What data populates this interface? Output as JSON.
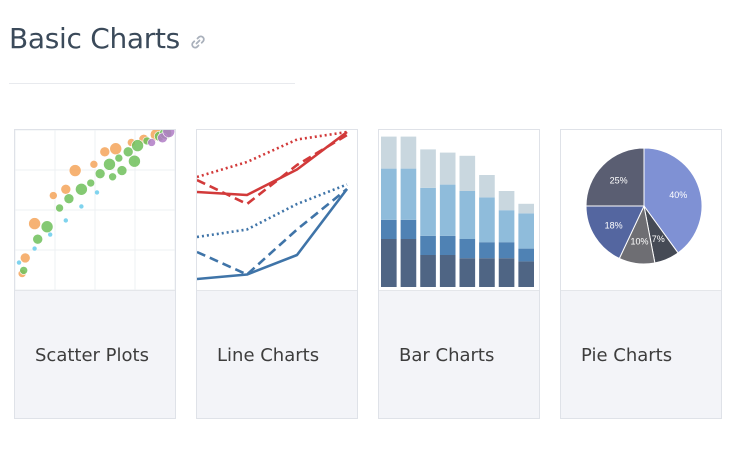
{
  "section": {
    "title": "Basic Charts",
    "link_icon": "link-icon"
  },
  "cards": [
    {
      "id": "scatter",
      "label": "Scatter Plots",
      "thumb_type": "scatter"
    },
    {
      "id": "line",
      "label": "Line Charts",
      "thumb_type": "line"
    },
    {
      "id": "bar",
      "label": "Bar Charts",
      "thumb_type": "bar"
    },
    {
      "id": "pie",
      "label": "Pie Charts",
      "thumb_type": "pie"
    }
  ],
  "chart_data": [
    {
      "type": "scatter",
      "title": "",
      "series": [
        {
          "color": "#f5a55a",
          "points": [
            [
              2,
              8
            ],
            [
              4,
              18
            ],
            [
              10,
              40
            ],
            [
              22,
              58
            ],
            [
              30,
              62
            ],
            [
              36,
              74
            ],
            [
              48,
              78
            ],
            [
              55,
              86
            ],
            [
              62,
              88
            ],
            [
              72,
              92
            ],
            [
              80,
              94
            ],
            [
              88,
              97
            ]
          ]
        },
        {
          "color": "#6fbf5a",
          "points": [
            [
              3,
              10
            ],
            [
              12,
              30
            ],
            [
              18,
              38
            ],
            [
              26,
              50
            ],
            [
              32,
              56
            ],
            [
              40,
              62
            ],
            [
              46,
              66
            ],
            [
              52,
              72
            ],
            [
              58,
              78
            ],
            [
              64,
              82
            ],
            [
              70,
              86
            ],
            [
              76,
              90
            ],
            [
              82,
              93
            ],
            [
              90,
              96
            ],
            [
              94,
              98
            ],
            [
              60,
              70
            ],
            [
              66,
              74
            ],
            [
              74,
              80
            ]
          ]
        },
        {
          "color": "#b07cc6",
          "points": [
            [
              85,
              92
            ],
            [
              92,
              95
            ],
            [
              96,
              99
            ]
          ]
        },
        {
          "color": "#7fd3ee",
          "points": [
            [
              0,
              15
            ],
            [
              10,
              24
            ],
            [
              20,
              33
            ],
            [
              30,
              42
            ],
            [
              40,
              51
            ],
            [
              50,
              60
            ]
          ]
        }
      ]
    },
    {
      "type": "line",
      "title": "",
      "series": [
        {
          "color": "#d23a3a",
          "style": "solid",
          "values": [
            60,
            58,
            75,
            100
          ]
        },
        {
          "color": "#d23a3a",
          "style": "dash",
          "values": [
            68,
            52,
            78,
            98
          ]
        },
        {
          "color": "#d23a3a",
          "style": "dot",
          "values": [
            70,
            80,
            95,
            100
          ]
        },
        {
          "color": "#3f74a8",
          "style": "solid",
          "values": [
            2,
            5,
            18,
            62
          ]
        },
        {
          "color": "#3f74a8",
          "style": "dash",
          "values": [
            20,
            5,
            35,
            62
          ]
        },
        {
          "color": "#3f74a8",
          "style": "dot",
          "values": [
            30,
            35,
            52,
            65
          ]
        }
      ]
    },
    {
      "type": "bar",
      "title": "",
      "colors": [
        "#4f6584",
        "#4f82b4",
        "#8fbcdb",
        "#c9d7df"
      ],
      "series": [
        {
          "values": [
            30,
            30,
            20,
            20,
            18,
            18,
            18,
            16
          ]
        },
        {
          "values": [
            12,
            12,
            12,
            12,
            12,
            10,
            10,
            8
          ]
        },
        {
          "values": [
            32,
            32,
            30,
            32,
            30,
            28,
            20,
            22
          ]
        },
        {
          "values": [
            20,
            20,
            24,
            20,
            22,
            14,
            12,
            6
          ]
        }
      ]
    },
    {
      "type": "pie",
      "title": "",
      "slices": [
        {
          "label": "40%",
          "value": 40,
          "color": "#7f91d4"
        },
        {
          "label": "7%",
          "value": 7,
          "color": "#454a55"
        },
        {
          "label": "10%",
          "value": 10,
          "color": "#6e6e73"
        },
        {
          "label": "18%",
          "value": 18,
          "color": "#5466a0"
        },
        {
          "label": "25%",
          "value": 25,
          "color": "#5a5e72"
        }
      ]
    }
  ]
}
